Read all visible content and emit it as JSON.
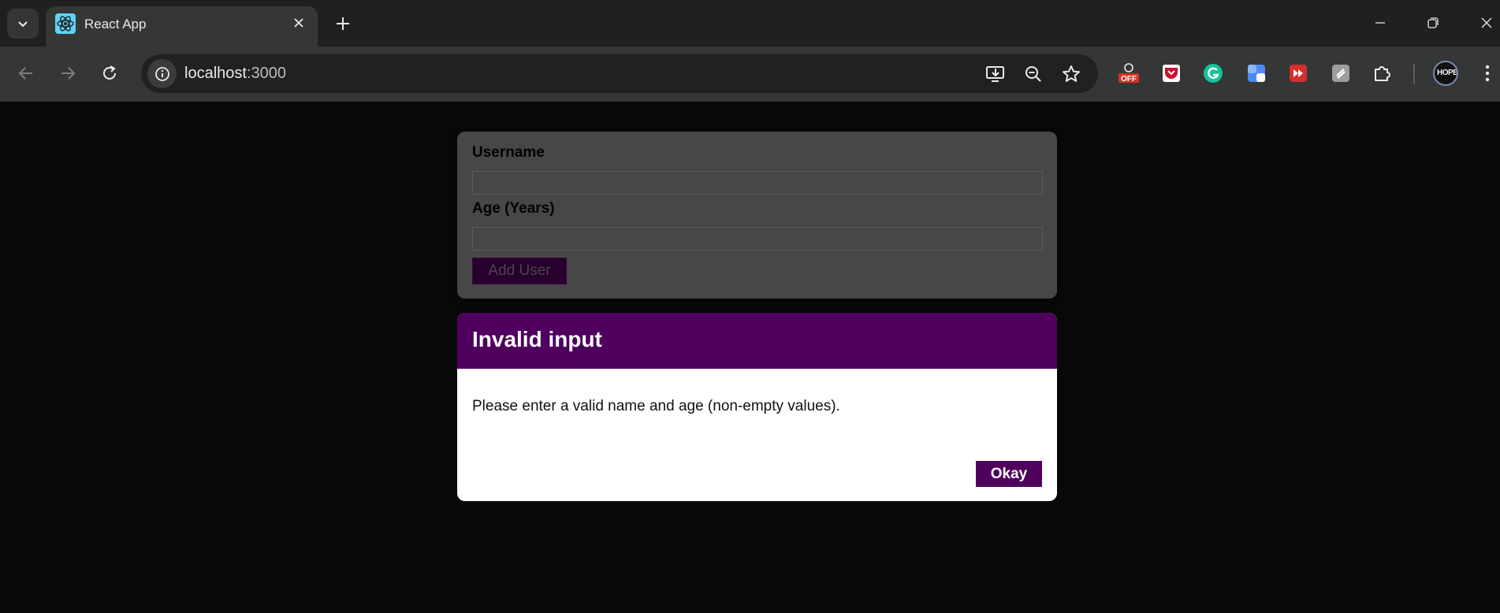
{
  "browser": {
    "tab": {
      "title": "React App"
    },
    "address": {
      "host": "localhost",
      "port": ":3000"
    }
  },
  "form": {
    "username_label": "Username",
    "username_value": "",
    "age_label": "Age (Years)",
    "age_value": "",
    "submit_label": "Add User"
  },
  "modal": {
    "title": "Invalid input",
    "message": "Please enter a valid name and age (non-empty values).",
    "confirm_label": "Okay"
  },
  "colors": {
    "modal_accent": "#4f005f",
    "page_background": "#080808",
    "form_background": "#474747"
  },
  "extensions": {
    "badge_text": "OFF",
    "avatar_text": "HOPE"
  }
}
